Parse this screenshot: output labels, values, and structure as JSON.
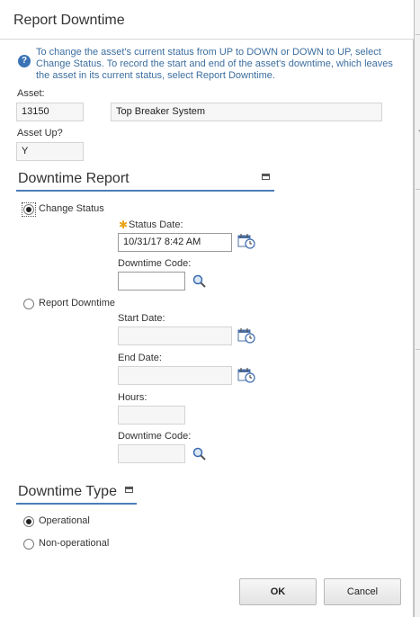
{
  "dialog": {
    "title": "Report Downtime",
    "info_text": "To change the asset's current status from UP to DOWN or DOWN to UP, select Change Status. To record the start and end of the asset's downtime, which leaves the asset in its current status, select Report Downtime."
  },
  "asset": {
    "label": "Asset:",
    "number": "13150",
    "description": "Top Breaker System",
    "up_label": "Asset Up?",
    "up_value": "Y"
  },
  "downtime_report": {
    "heading": "Downtime Report",
    "change_status": {
      "label": "Change Status",
      "selected": true,
      "status_date_label": "Status Date:",
      "status_date_value": "10/31/17 8:42 AM",
      "downtime_code_label": "Downtime Code:",
      "downtime_code_value": ""
    },
    "report_downtime": {
      "label": "Report Downtime",
      "selected": false,
      "start_date_label": "Start Date:",
      "end_date_label": "End Date:",
      "hours_label": "Hours:",
      "downtime_code_label": "Downtime Code:"
    }
  },
  "downtime_type": {
    "heading": "Downtime Type",
    "options": [
      {
        "label": "Operational",
        "selected": true
      },
      {
        "label": "Non-operational",
        "selected": false
      }
    ]
  },
  "buttons": {
    "ok": "OK",
    "cancel": "Cancel"
  },
  "colors": {
    "accent": "#4a7db8",
    "info_text": "#3c6e9f",
    "required": "#e8a317"
  },
  "icons": {
    "info": "info-icon",
    "calendar": "calendar-clock-icon",
    "lookup": "magnifier-icon",
    "collapse": "collapse-section-icon"
  }
}
